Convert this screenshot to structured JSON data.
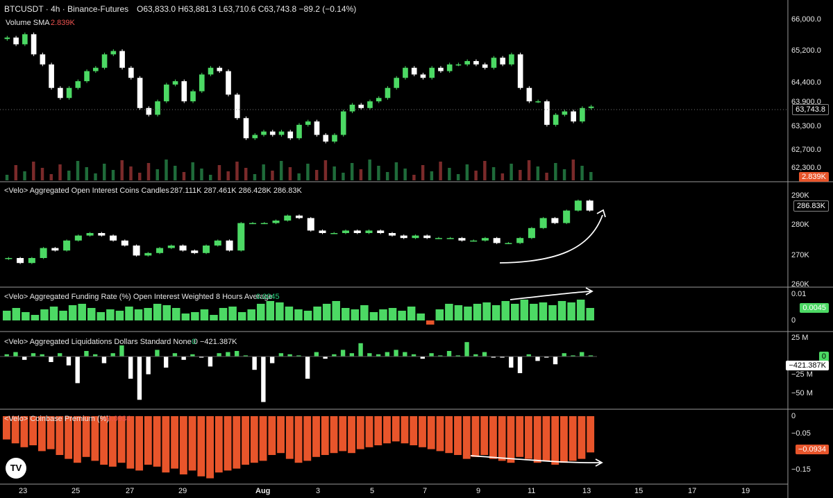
{
  "header": {
    "symbol": "BTCUSDT · 4h · Binance-Futures",
    "ohlc": "O63,833.0 H63,881.3 L63,710.6 C63,743.8 −89.2 (−0.14%)",
    "volume_label": "Volume SMA",
    "volume_value": "2.839K"
  },
  "colors": {
    "up": "#4cd964",
    "down": "#ffffff",
    "premium": "#e8552b",
    "funding": "#4cd964",
    "vol_up": "#1f6b3a",
    "vol_down": "#7a2a2a"
  },
  "price_axis": [
    "66,000.0",
    "65,200.0",
    "64,400.0",
    "63,900.0",
    "63,300.0",
    "62,700.0",
    "62,300.0"
  ],
  "price_tag": "63,743.8",
  "vol_tag": "2.839K",
  "oi_panel": {
    "title": "<Velo> Aggregated Open Interest Coins Candles",
    "values": "287.111K  287.461K  286.428K  286.83K",
    "axis": [
      "290K",
      "280K",
      "270K",
      "260K"
    ],
    "tag": "286.83K"
  },
  "funding_panel": {
    "title": "<Velo> Aggregated Funding Rate (%) Open Interest Weighted 8 Hours Average",
    "value": "0.0045",
    "axis": [
      "0.01",
      "0"
    ],
    "tag": "0.0045"
  },
  "liq_panel": {
    "title": "<Velo> Aggregated Liquidations Dollars Standard None 0",
    "value0": "0",
    "value": "−421.387K",
    "axis": [
      "25 M",
      "−25 M",
      "−50 M"
    ],
    "tag0": "0",
    "tag": "−421.387K"
  },
  "premium_panel": {
    "title": "<Velo> Coinbase Premium (%)",
    "value": "−0.0934",
    "axis": [
      "0",
      "−0.05",
      "−0.15"
    ],
    "tag": "−0.0934"
  },
  "time_axis": [
    "23",
    "25",
    "27",
    "29",
    "Aug",
    "3",
    "5",
    "7",
    "9",
    "11",
    "13",
    "15",
    "17",
    "19"
  ],
  "logo_text": "TV",
  "chart_data": [
    {
      "type": "candlestick",
      "title": "BTCUSDT · 4h · Binance-Futures",
      "ylim": [
        62000,
        66300
      ],
      "close_series": [
        65800,
        65600,
        65900,
        65300,
        65000,
        64300,
        64000,
        64300,
        64500,
        64800,
        64900,
        65300,
        65400,
        64900,
        64600,
        63700,
        63500,
        63900,
        64400,
        64500,
        63900,
        64200,
        64700,
        64900,
        64800,
        64100,
        63400,
        62800,
        62900,
        63000,
        62900,
        63000,
        62800,
        63200,
        63300,
        62900,
        62700,
        62900,
        63600,
        63800,
        63700,
        63900,
        64000,
        64300,
        64600,
        64900,
        64700,
        64600,
        64900,
        64800,
        65000,
        65000,
        65100,
        65000,
        64900,
        65200,
        65000,
        65300,
        64300,
        63900,
        63900,
        63200,
        63500,
        63600,
        63300,
        63700,
        63744
      ]
    },
    {
      "type": "candlestick",
      "title": "<Velo> Aggregated Open Interest Coins Candles",
      "ylim": [
        258000,
        293000
      ],
      "close_series": [
        268000,
        266000,
        268000,
        272000,
        271000,
        275000,
        277000,
        278000,
        277000,
        275000,
        273000,
        269000,
        270000,
        272000,
        273000,
        271000,
        270000,
        273000,
        275000,
        271000,
        282000,
        282000,
        282000,
        283000,
        285000,
        284000,
        279000,
        278000,
        278000,
        279000,
        278000,
        279000,
        278000,
        277000,
        276000,
        277000,
        276000,
        276000,
        276000,
        275000,
        275000,
        276000,
        274000,
        274000,
        276000,
        280000,
        284000,
        282000,
        287000,
        291000,
        287000
      ]
    },
    {
      "type": "bar",
      "title": "<Velo> Aggregated Funding Rate (%) Open Interest Weighted 8 Hours Average",
      "values": [
        0.0035,
        0.0045,
        0.003,
        0.002,
        0.004,
        0.005,
        0.0035,
        0.0055,
        0.006,
        0.0045,
        0.003,
        0.004,
        0.0035,
        0.005,
        0.004,
        0.0045,
        0.006,
        0.0055,
        0.0045,
        0.0025,
        0.003,
        0.004,
        0.002,
        0.0045,
        0.005,
        0.003,
        0.004,
        0.006,
        0.007,
        0.0065,
        0.005,
        0.004,
        0.0035,
        0.005,
        0.006,
        0.007,
        0.0045,
        0.004,
        0.0055,
        0.003,
        0.004,
        0.0045,
        0.0035,
        0.005,
        0.0025,
        -0.0015,
        0.004,
        0.006,
        0.0055,
        0.005,
        0.006,
        0.0065,
        0.0055,
        0.007,
        0.006,
        0.0075,
        0.006,
        0.0065,
        0.0055,
        0.007,
        0.0065,
        0.0075,
        0.0045
      ]
    },
    {
      "type": "bar",
      "title": "<Velo> Aggregated Liquidations Dollars Standard None 0",
      "values": [
        2,
        4,
        -3,
        3,
        2,
        -5,
        3,
        -8,
        -24,
        5,
        2,
        -6,
        3,
        10,
        -20,
        -39,
        -16,
        6,
        -10,
        3,
        -3,
        2,
        -1,
        -9,
        3,
        4,
        5,
        1,
        -12,
        -41,
        -6,
        3,
        2,
        1,
        -20,
        4,
        -2,
        2,
        6,
        3,
        12,
        3,
        2,
        4,
        6,
        4,
        2,
        -2,
        3,
        1,
        5,
        1,
        13,
        2,
        4,
        -1,
        -1,
        -10,
        -15,
        2,
        -4,
        -1,
        -7,
        3,
        1,
        4,
        1
      ]
    },
    {
      "type": "bar",
      "title": "<Velo> Coinbase Premium (%)",
      "values": [
        -0.06,
        -0.07,
        -0.08,
        -0.075,
        -0.09,
        -0.085,
        -0.1,
        -0.11,
        -0.12,
        -0.105,
        -0.115,
        -0.125,
        -0.13,
        -0.12,
        -0.135,
        -0.14,
        -0.125,
        -0.13,
        -0.145,
        -0.135,
        -0.15,
        -0.14,
        -0.155,
        -0.16,
        -0.145,
        -0.14,
        -0.135,
        -0.125,
        -0.12,
        -0.115,
        -0.1,
        -0.095,
        -0.11,
        -0.12,
        -0.115,
        -0.105,
        -0.1,
        -0.095,
        -0.09,
        -0.095,
        -0.085,
        -0.08,
        -0.075,
        -0.07,
        -0.065,
        -0.07,
        -0.075,
        -0.08,
        -0.085,
        -0.09,
        -0.095,
        -0.1,
        -0.11,
        -0.105,
        -0.1,
        -0.11,
        -0.115,
        -0.12,
        -0.105,
        -0.11,
        -0.12,
        -0.115,
        -0.125,
        -0.12,
        -0.115,
        -0.11,
        -0.0934
      ]
    }
  ]
}
